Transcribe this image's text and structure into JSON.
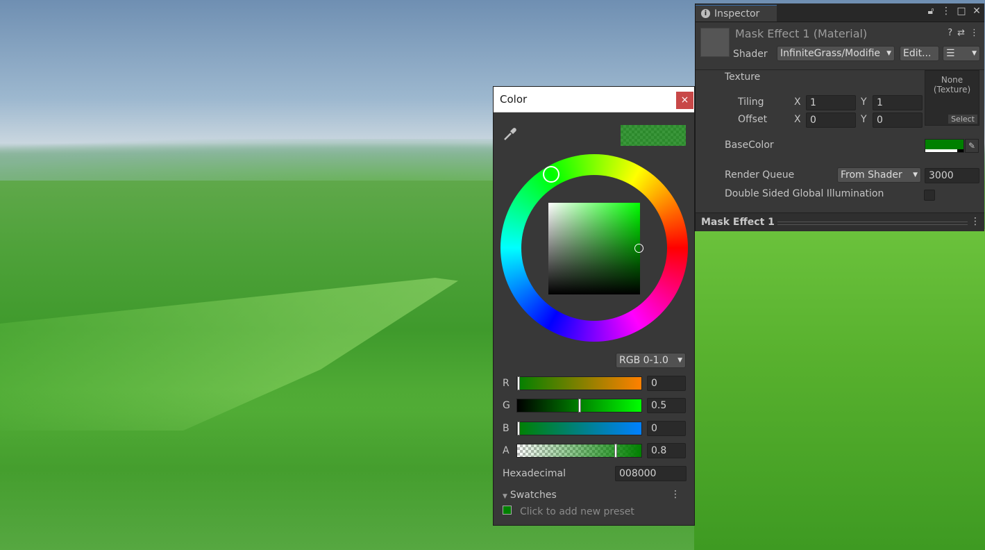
{
  "inspector": {
    "tab_label": "Inspector",
    "material_name": "Mask Effect 1 (Material)",
    "shader_label": "Shader",
    "shader_value": "InfiniteGrass/Modifie",
    "edit_button": "Edit...",
    "texture_label": "Texture",
    "texture_slot_line1": "None",
    "texture_slot_line2": "(Texture)",
    "texture_select": "Select",
    "tiling_label": "Tiling",
    "offset_label": "Offset",
    "x_label": "X",
    "y_label": "Y",
    "tiling_x": "1",
    "tiling_y": "1",
    "offset_x": "0",
    "offset_y": "0",
    "basecolor_label": "BaseColor",
    "basecolor_hex": "#008000",
    "render_queue_label": "Render Queue",
    "render_queue_mode": "From Shader",
    "render_queue_value": "3000",
    "dsgi_label": "Double Sided Global Illumination",
    "section_title": "Mask Effect 1"
  },
  "color_window": {
    "title": "Color",
    "close_glyph": "×",
    "mode": "RGB 0-1.0",
    "channels": [
      {
        "label": "R",
        "value": "0",
        "fraction": 0.0
      },
      {
        "label": "G",
        "value": "0.5",
        "fraction": 0.5
      },
      {
        "label": "B",
        "value": "0",
        "fraction": 0.0
      },
      {
        "label": "A",
        "value": "0.8",
        "fraction": 0.8
      }
    ],
    "hex_label": "Hexadecimal",
    "hex_value": "008000",
    "swatches_label": "Swatches",
    "swatches_hint": "Click to add new preset",
    "current_color": "#008000"
  },
  "colors": {
    "panel_bg": "#383838",
    "field_bg": "#2a2a2a",
    "accent_blue": "#3a72b0",
    "close_red": "#c84848"
  }
}
